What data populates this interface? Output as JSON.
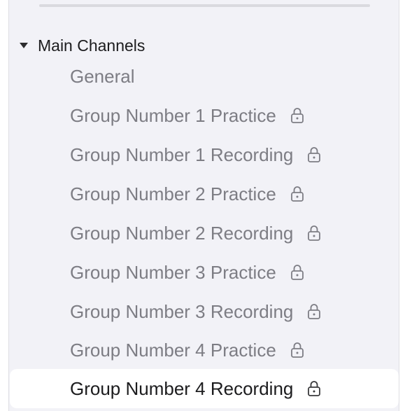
{
  "section": {
    "title": "Main Channels"
  },
  "channels": [
    {
      "label": "General",
      "locked": false
    },
    {
      "label": "Group Number 1 Practice",
      "locked": true
    },
    {
      "label": "Group Number 1 Recording",
      "locked": true
    },
    {
      "label": "Group Number 2 Practice",
      "locked": true
    },
    {
      "label": "Group Number 2 Recording",
      "locked": true
    },
    {
      "label": "Group Number 3 Practice",
      "locked": true
    },
    {
      "label": "Group Number 3 Recording",
      "locked": true
    },
    {
      "label": "Group Number 4 Practice",
      "locked": true
    },
    {
      "label": "Group Number 4 Recording",
      "locked": true,
      "selected": true
    }
  ],
  "icons": {
    "disclosure": "triangle-down-icon",
    "lock": "lock-icon"
  },
  "colors": {
    "panel_bg": "#f2f2f7",
    "selected_bg": "#ffffff",
    "text_muted": "#7d7d84",
    "text_primary": "#1c1c1e"
  }
}
